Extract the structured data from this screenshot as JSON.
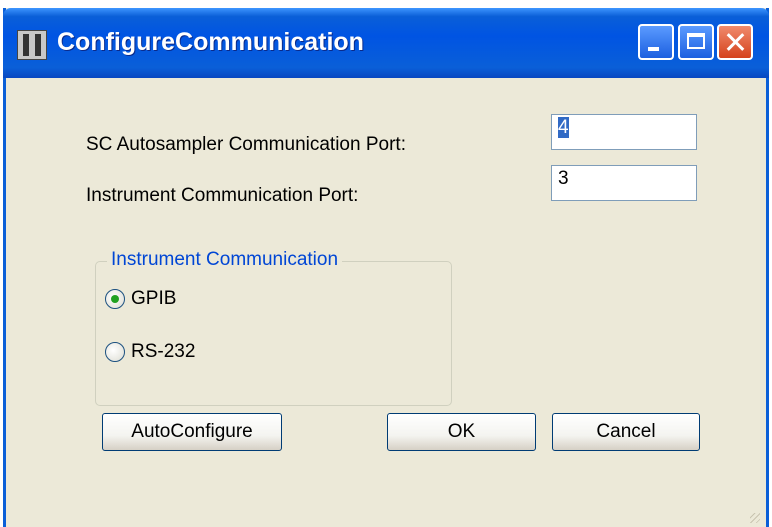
{
  "window": {
    "title": "ConfigureCommunication",
    "icon": "app-icon",
    "caption_buttons": [
      "minimize-icon",
      "maximize-icon",
      "close-icon"
    ]
  },
  "ports": {
    "sc_label": "SC Autosampler Communication Port:",
    "sc_value": "4",
    "instrument_label": "Instrument Communication Port:",
    "instrument_value": "3"
  },
  "group": {
    "title": "Instrument Communication",
    "options": [
      {
        "label": "GPIB",
        "checked": true
      },
      {
        "label": "RS-232",
        "checked": false
      }
    ]
  },
  "buttons": {
    "autoconfigure": "AutoConfigure",
    "ok": "OK",
    "cancel": "Cancel"
  },
  "colors": {
    "titlebar": "#0054e3",
    "dialog_bg": "#ece9d8",
    "group_title": "#0046d5",
    "radio_checked": "#21a121"
  }
}
